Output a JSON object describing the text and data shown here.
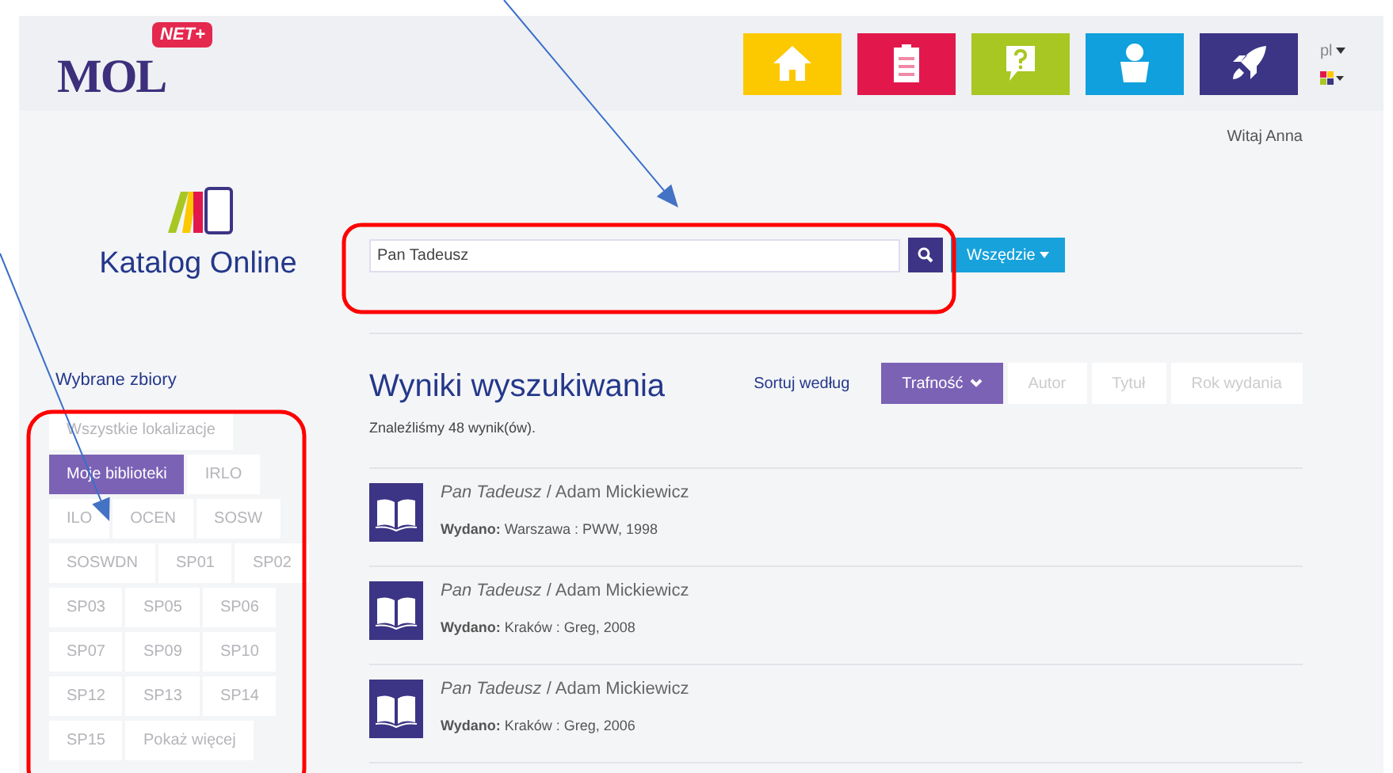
{
  "header": {
    "logo": "MOL",
    "logo_badge": "NET+",
    "nav": [
      {
        "kind": "home",
        "color": "#fcc800"
      },
      {
        "kind": "clipboard",
        "color": "#e2184c"
      },
      {
        "kind": "help",
        "color": "#a8c722"
      },
      {
        "kind": "user",
        "color": "#0fa0dd"
      },
      {
        "kind": "rocket",
        "color": "#3c3484"
      }
    ],
    "language": "pl",
    "greeting": "Witaj Anna"
  },
  "catalog_title": "Katalog Online",
  "search": {
    "value": "Pan Tadeusz",
    "scope": "Wszędzie"
  },
  "collections": {
    "title": "Wybrane zbiory",
    "rows": [
      [
        {
          "label": "Wszystkie lokalizacje",
          "selected": false
        }
      ],
      [
        {
          "label": "Moje biblioteki",
          "selected": true
        },
        {
          "label": "IRLO",
          "selected": false
        }
      ],
      [
        {
          "label": "ILO",
          "selected": false
        },
        {
          "label": "OCEN",
          "selected": false
        },
        {
          "label": "SOSW",
          "selected": false
        }
      ],
      [
        {
          "label": "SOSWDN",
          "selected": false
        },
        {
          "label": "SP01",
          "selected": false
        },
        {
          "label": "SP02",
          "selected": false
        }
      ],
      [
        {
          "label": "SP03",
          "selected": false
        },
        {
          "label": "SP05",
          "selected": false
        },
        {
          "label": "SP06",
          "selected": false
        }
      ],
      [
        {
          "label": "SP07",
          "selected": false
        },
        {
          "label": "SP09",
          "selected": false
        },
        {
          "label": "SP10",
          "selected": false
        }
      ],
      [
        {
          "label": "SP12",
          "selected": false
        },
        {
          "label": "SP13",
          "selected": false
        },
        {
          "label": "SP14",
          "selected": false
        }
      ],
      [
        {
          "label": "SP15",
          "selected": false
        },
        {
          "label": "Pokaż więcej",
          "selected": false
        }
      ]
    ]
  },
  "results": {
    "title": "Wyniki wyszukiwania",
    "count": "Znaleźliśmy 48 wynik(ów).",
    "sort_label": "Sortuj według",
    "sort_options": [
      {
        "label": "Trafność",
        "selected": true
      },
      {
        "label": "Autor",
        "selected": false
      },
      {
        "label": "Tytuł",
        "selected": false
      },
      {
        "label": "Rok wydania",
        "selected": false
      }
    ],
    "items": [
      {
        "title": "*Pan Tadeusz* / Adam Mickiewicz",
        "published": "**Wydano:** Warszawa : PWW, 1998"
      },
      {
        "title": "*Pan Tadeusz* / Adam Mickiewicz",
        "published": "**Wydano:** Kraków : Greg, 2008"
      },
      {
        "title": "*Pan Tadeusz* / Adam Mickiewicz",
        "published": "**Wydano:** Kraków : Greg, 2006"
      }
    ]
  },
  "annotations": [
    {
      "kind": "arrow"
    },
    {
      "kind": "arrow"
    },
    {
      "kind": "frame"
    },
    {
      "kind": "frame"
    }
  ]
}
